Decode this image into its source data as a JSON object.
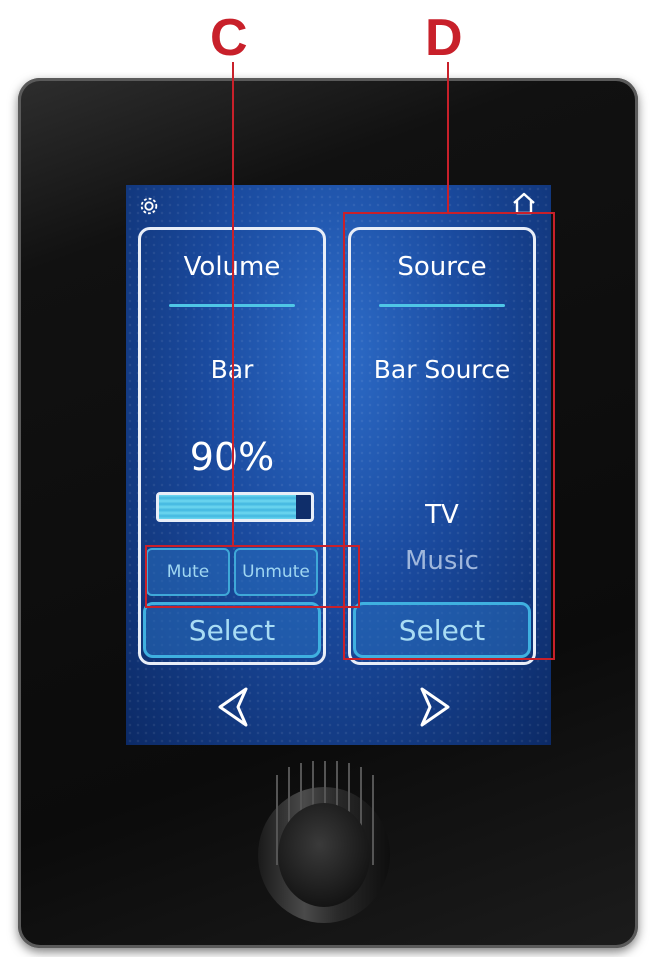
{
  "callouts": {
    "c_label": "C",
    "d_label": "D"
  },
  "header": {
    "settings_icon": "gear-icon",
    "home_icon": "home-icon"
  },
  "volume_panel": {
    "title": "Volume",
    "zone": "Bar",
    "level_text": "90%",
    "level_fraction": 0.9,
    "mute_label": "Mute",
    "unmute_label": "Unmute",
    "select_label": "Select"
  },
  "source_panel": {
    "title": "Source",
    "subtitle": "Bar Source",
    "sources": [
      {
        "label": "TV",
        "selected": true
      },
      {
        "label": "Music",
        "selected": false
      }
    ],
    "select_label": "Select"
  },
  "nav": {
    "prev_icon": "chevron-left-icon",
    "next_icon": "chevron-right-icon"
  },
  "colors": {
    "callout_red": "#c8202a",
    "accent_cyan": "#4fc6e6",
    "screen_blue": "#1a4a9e"
  }
}
